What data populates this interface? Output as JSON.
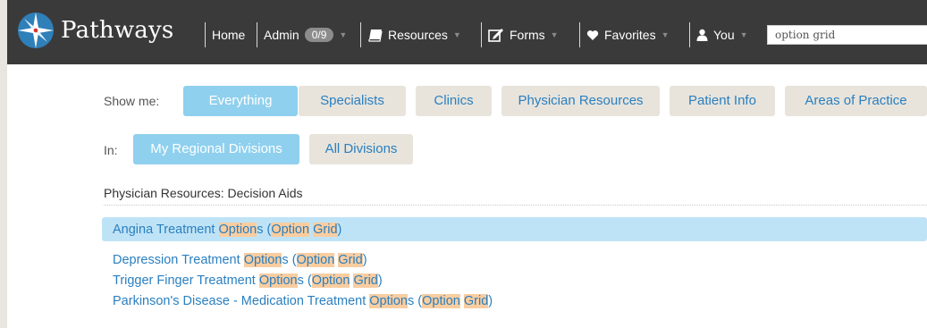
{
  "brand": {
    "name": "Pathways",
    "logo_icon": "compass-star-icon"
  },
  "nav": {
    "home": "Home",
    "admin": {
      "label": "Admin",
      "badge": "0/9"
    },
    "resources": "Resources",
    "forms": "Forms",
    "favorites": "Favorites",
    "you": "You"
  },
  "search": {
    "value": "option grid"
  },
  "filters": {
    "show_me_label": "Show me:",
    "show_me_options": [
      {
        "label": "Everything",
        "active": true
      },
      {
        "label": "Specialists",
        "active": false
      },
      {
        "label": "Clinics",
        "active": false
      },
      {
        "label": "Physician Resources",
        "active": false
      },
      {
        "label": "Patient Info",
        "active": false
      },
      {
        "label": "Areas of Practice",
        "active": false
      }
    ],
    "in_label": "In:",
    "in_options": [
      {
        "label": "My Regional Divisions",
        "active": true
      },
      {
        "label": "All Divisions",
        "active": false
      }
    ]
  },
  "results": {
    "heading": "Physician Resources: Decision Aids",
    "items": [
      {
        "text": "Angina Treatment Options (Option Grid)",
        "selected": true
      },
      {
        "text": "Depression Treatment Options (Option Grid)",
        "selected": false
      },
      {
        "text": "Trigger Finger Treatment Options (Option Grid)",
        "selected": false
      },
      {
        "text": "Parkinson's Disease - Medication Treatment Options (Option Grid)",
        "selected": false
      }
    ]
  },
  "colors": {
    "navbar": "#3a3a3a",
    "accent_active": "#8fd0ee",
    "link": "#2a7fc0",
    "selected_row": "#bfe3f6",
    "match_highlight": "#f9cda0"
  }
}
